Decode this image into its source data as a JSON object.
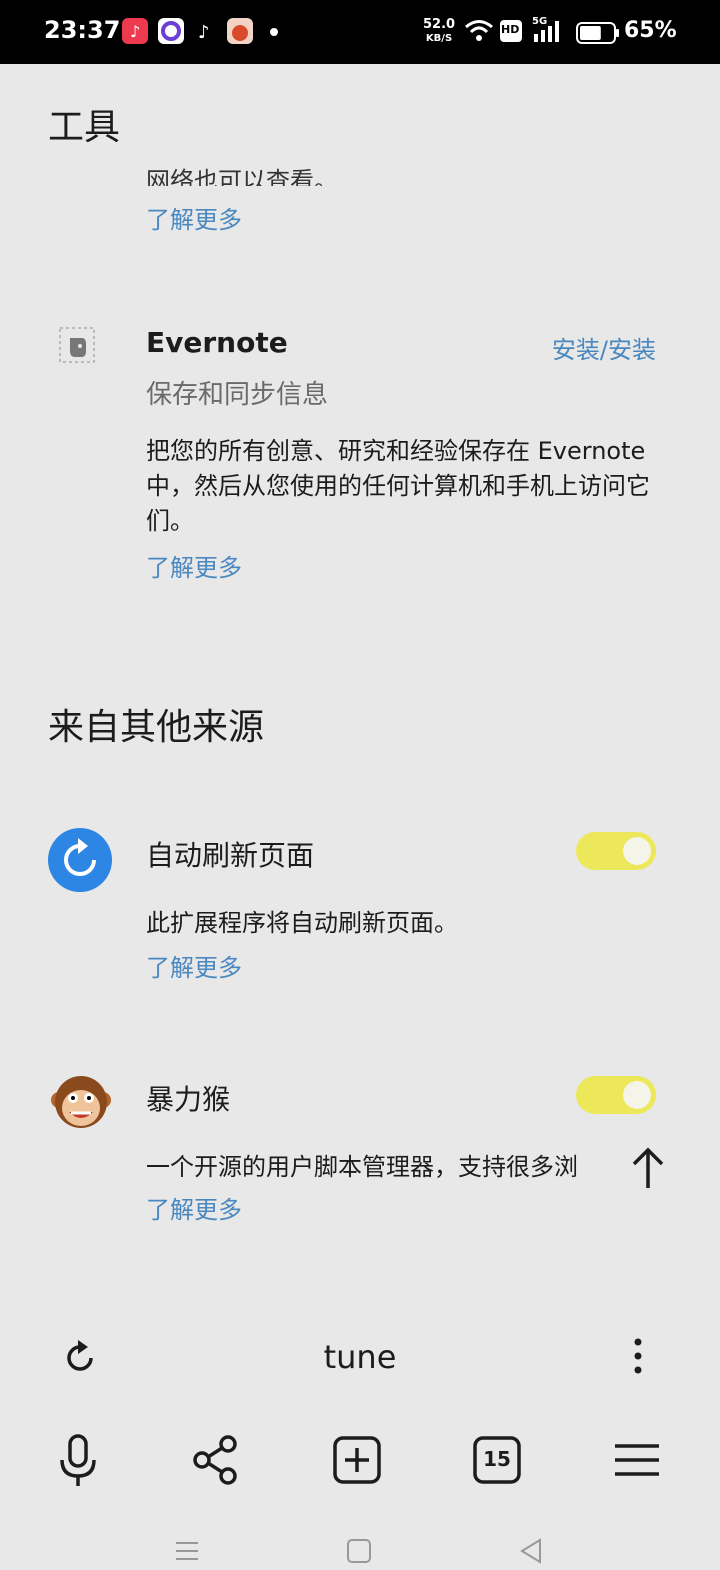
{
  "status_bar": {
    "time": "23:37",
    "net_speed_value": "52.0",
    "net_speed_unit": "KB/S",
    "hd_label": "HD",
    "network_label": "5G",
    "battery_percent": "65%",
    "battery_level": 0.65
  },
  "sections": {
    "tools": {
      "title": "工具"
    },
    "other_sources": {
      "title": "来自其他来源"
    }
  },
  "partial_item": {
    "desc_tail": "网络也可以查看。",
    "learn_more": "了解更多"
  },
  "evernote": {
    "name": "Evernote",
    "subtitle": "保存和同步信息",
    "install_label": "安装/安装",
    "description": "把您的所有创意、研究和经验保存在 Evernote 中，然后从您使用的任何计算机和手机上访问它们。",
    "learn_more": "了解更多"
  },
  "auto_refresh": {
    "name": "自动刷新页面",
    "description": "此扩展程序将自动刷新页面。",
    "learn_more": "了解更多",
    "enabled": true,
    "icon": "refresh-circle-icon",
    "color": "#2d85e4"
  },
  "violentmonkey": {
    "name": "暴力猴",
    "description": "一个开源的用户脚本管理器，支持很多浏",
    "learn_more": "了解更多",
    "enabled": true,
    "icon": "monkey-icon"
  },
  "address_bar": {
    "text": "tune"
  },
  "toolbar": {
    "tab_count": "15"
  },
  "colors": {
    "link": "#4a88bf",
    "toggle_on": "#ece85a",
    "background": "#e8e8e8"
  }
}
